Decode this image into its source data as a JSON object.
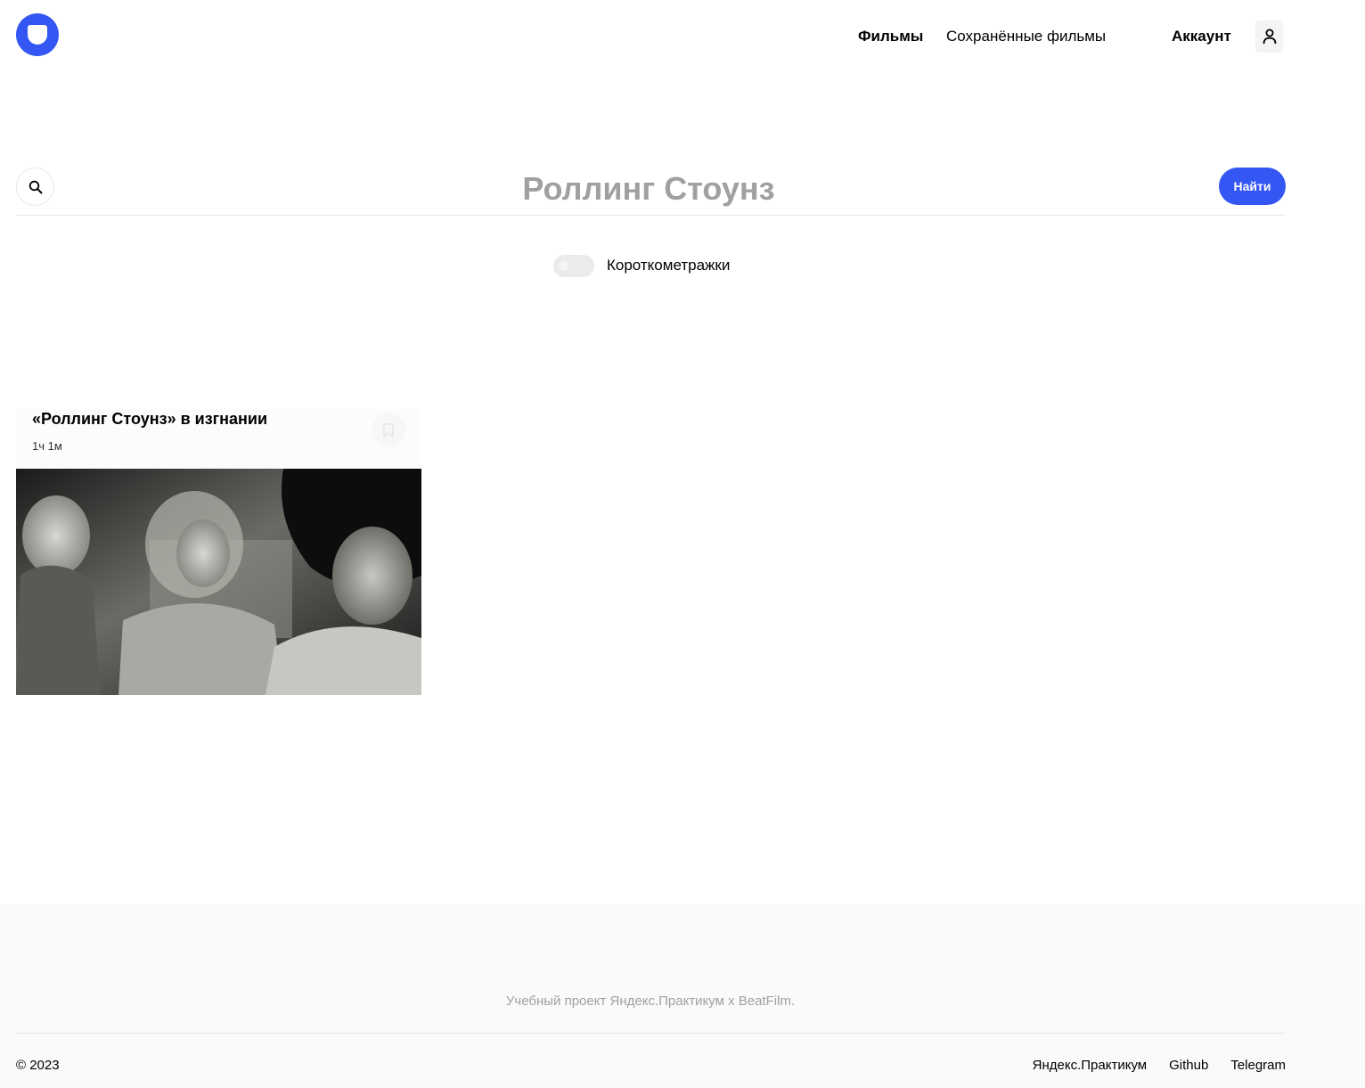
{
  "header": {
    "logo_icon": "app-logo-icon",
    "nav": {
      "films_label": "Фильмы",
      "saved_label": "Сохранённые фильмы"
    },
    "account": {
      "label": "Аккаунт",
      "icon": "user-icon"
    }
  },
  "search": {
    "icon": "search-icon",
    "value": "Роллинг Стоунз",
    "button_label": "Найти"
  },
  "filter": {
    "short_films_label": "Короткометражки",
    "short_films_enabled": false
  },
  "movies": [
    {
      "title": "«Роллинг Стоунз» в изгнании",
      "duration": "1ч 1м",
      "saved": false,
      "save_icon": "bookmark-icon"
    }
  ],
  "footer": {
    "note": "Учебный проект Яндекс.Практикум х BeatFilm.",
    "copyright": "© 2023",
    "links": [
      "Яндекс.Практикум",
      "Github",
      "Telegram"
    ]
  },
  "colors": {
    "accent": "#3456F3",
    "muted_text": "#A0A0A0",
    "footer_bg": "#FAFAFA"
  }
}
